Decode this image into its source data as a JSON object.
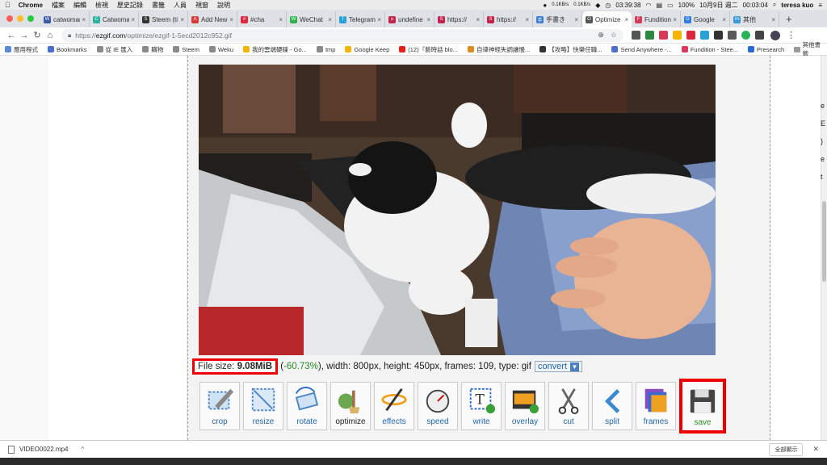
{
  "menubar": {
    "app_name": "Chrome",
    "items": [
      "檔案",
      "編輯",
      "檢視",
      "歷史記錄",
      "書籤",
      "人員",
      "視窗",
      "說明"
    ],
    "net_up": "0.1KB/s",
    "net_down": "0.1KB/s",
    "timer": "03:39:38",
    "battery": "100%",
    "date": "10月9日 週二",
    "time": "00:03:04",
    "user": "teresa kuo"
  },
  "tabs": [
    {
      "label": "catwoman",
      "color": "#3b5ba5",
      "glyph": "W"
    },
    {
      "label": "Catwoman",
      "color": "#2bb3a0",
      "glyph": "C"
    },
    {
      "label": "Steem (ti",
      "color": "#333333",
      "glyph": "S"
    },
    {
      "label": "Add New",
      "color": "#d83a3a",
      "glyph": "A"
    },
    {
      "label": "#cha",
      "color": "#e0283c",
      "glyph": "#"
    },
    {
      "label": "WeChat",
      "color": "#2db34a",
      "glyph": "W"
    },
    {
      "label": "Telegram",
      "color": "#2aa1da",
      "glyph": "T"
    },
    {
      "label": "undefine",
      "color": "#c4244c",
      "glyph": "u"
    },
    {
      "label": "https://",
      "color": "#c4244c",
      "glyph": "S"
    },
    {
      "label": "https://",
      "color": "#c4244c",
      "glyph": "S"
    },
    {
      "label": "手書き",
      "color": "#3a7bd5",
      "glyph": "手"
    },
    {
      "label": "Optimize",
      "color": "#555555",
      "glyph": "O"
    },
    {
      "label": "Fundition",
      "color": "#d83a5a",
      "glyph": "F"
    },
    {
      "label": "Google",
      "color": "#2f7de1",
      "glyph": "G"
    },
    {
      "label": "其他",
      "color": "#3a9ad9",
      "glyph": "m"
    }
  ],
  "active_tab_index": 11,
  "newtab_label": "+",
  "address": {
    "protocol": "https://",
    "host": "ezgif.com",
    "path": "/optimize/ezgif-1-5ecd2012c952.gif"
  },
  "bookmarks": [
    {
      "label": "應用程式",
      "color": "#5a8ad5"
    },
    {
      "label": "Bookmarks",
      "color": "#4a6fd0"
    },
    {
      "label": "從 IE 匯入",
      "color": "#8a8a8a"
    },
    {
      "label": "購物",
      "color": "#8a8a8a"
    },
    {
      "label": "Steem",
      "color": "#8a8a8a"
    },
    {
      "label": "Weku",
      "color": "#8a8a8a"
    },
    {
      "label": "我的雲端硬碟 - Go...",
      "color": "#f4b400"
    },
    {
      "label": "tmp",
      "color": "#8a8a8a"
    },
    {
      "label": "Google Keep",
      "color": "#f4b400"
    },
    {
      "label": "(12)『藝時話 blo...",
      "color": "#e62117"
    },
    {
      "label": "自律神經失調讓慢...",
      "color": "#e08a20"
    },
    {
      "label": "【攻略】快樂任職...",
      "color": "#333333"
    },
    {
      "label": "Send Anywhere -...",
      "color": "#4a6fd0"
    },
    {
      "label": "Fundition - Stee...",
      "color": "#d83a5a"
    },
    {
      "label": "Presearch",
      "color": "#2a6ad0"
    }
  ],
  "bookmarks_other": "其他書籤",
  "file_info": {
    "label": "File size: ",
    "size": "9.08MiB",
    "percent": "-60.73%",
    "rest": "), width: 800px, height: 450px, frames: 109, type: gif",
    "convert_label": "convert"
  },
  "tools": [
    {
      "label": "crop",
      "icon": "crop-icon"
    },
    {
      "label": "resize",
      "icon": "resize-icon"
    },
    {
      "label": "rotate",
      "icon": "rotate-icon"
    },
    {
      "label": "optimize",
      "icon": "optimize-icon"
    },
    {
      "label": "effects",
      "icon": "effects-icon"
    },
    {
      "label": "speed",
      "icon": "speed-icon"
    },
    {
      "label": "write",
      "icon": "write-icon"
    },
    {
      "label": "overlay",
      "icon": "overlay-icon"
    },
    {
      "label": "cut",
      "icon": "cut-icon"
    },
    {
      "label": "split",
      "icon": "split-icon"
    },
    {
      "label": "frames",
      "icon": "frames-icon"
    },
    {
      "label": "save",
      "icon": "save-icon"
    }
  ],
  "edge_text": [
    "e",
    "E",
    ")",
    "e",
    "t"
  ],
  "download": {
    "filename": "VIDEO0022.mp4",
    "show_all": "全部顯示"
  },
  "colors": {
    "highlight": "#e00000",
    "link": "#2266aa",
    "percent_green": "#2a8a2a"
  }
}
